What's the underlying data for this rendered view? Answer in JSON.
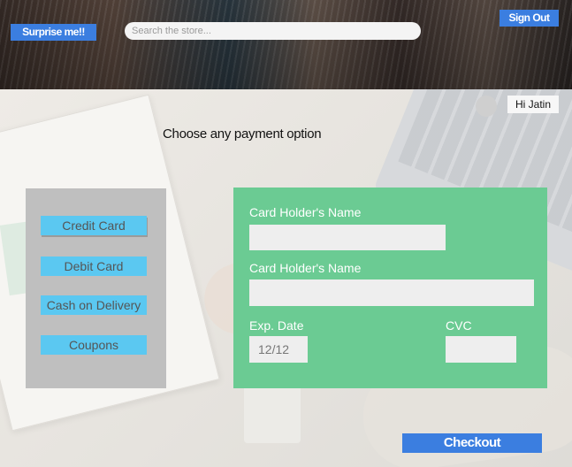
{
  "header": {
    "brand_button": "Surprise me!!",
    "search_placeholder": "Search the store...",
    "signout_button": "Sign Out"
  },
  "user": {
    "greeting": "Hi Jatin"
  },
  "page": {
    "title": "Choose any payment option"
  },
  "payment_options": [
    {
      "label": "Credit Card",
      "selected": true
    },
    {
      "label": "Debit Card"
    },
    {
      "label": "Cash on Delivery"
    },
    {
      "label": "Coupons"
    }
  ],
  "card_form": {
    "name_label": "Card Holder's Name",
    "number_label": "Card Holder's Name",
    "exp_label": "Exp. Date",
    "exp_value": "12/12",
    "cvc_label": "CVC",
    "cvc_value": ""
  },
  "checkout_button": "Checkout",
  "colors": {
    "accent_blue": "#3b7ee0",
    "option_blue": "#5bc8f1",
    "form_green": "#6bcb93",
    "options_panel": "#bfbfbf"
  }
}
